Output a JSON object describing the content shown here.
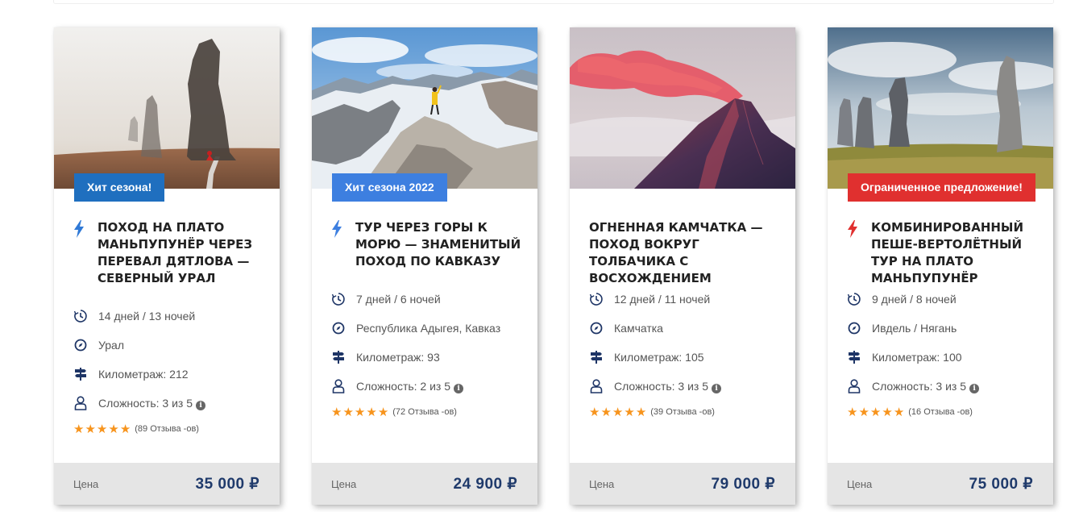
{
  "colors": {
    "accent_blue": "#2f79d6",
    "badge_blue_dark": "#1f6fbf",
    "badge_blue_light": "#3d7fe0",
    "badge_red": "#e0302f",
    "price_navy": "#1f3a6b",
    "star_orange": "#f7941d",
    "icon_navy": "#1e3566"
  },
  "cards": [
    {
      "badge": "Хит сезона!",
      "badge_color": "#1f6fbf",
      "bolt_color": "#2f79d6",
      "has_bolt": true,
      "title": "Поход на плато Маньпупунёр через перевал Дятлова — Северный Урал",
      "duration": "14 дней / 13 ночей",
      "location": "Урал",
      "mileage": "Километраж: 212",
      "difficulty": "Сложность: 3 из 5",
      "rating": 5,
      "reviews": "(89 Отзыва -ов)",
      "price_label": "Цена",
      "price": "35 000 ₽"
    },
    {
      "badge": "Хит сезона 2022",
      "badge_color": "#3d7fe0",
      "bolt_color": "#3d7fe0",
      "has_bolt": true,
      "title": "Тур через горы к морю — знаменитый поход по Кавказу",
      "duration": "7 дней / 6 ночей",
      "location": "Республика Адыгея, Кавказ",
      "mileage": "Километраж: 93",
      "difficulty": "Сложность: 2 из 5",
      "rating": 5,
      "reviews": "(72 Отзыва -ов)",
      "price_label": "Цена",
      "price": "24 900 ₽"
    },
    {
      "badge": "",
      "badge_color": "",
      "bolt_color": "",
      "has_bolt": false,
      "title": "Огненная Камчатка — поход вокруг Толбачика с восхождением",
      "duration": "12 дней / 11 ночей",
      "location": "Камчатка",
      "mileage": "Километраж: 105",
      "difficulty": "Сложность: 3 из 5",
      "rating": 5,
      "reviews": "(39 Отзыва -ов)",
      "price_label": "Цена",
      "price": "79 000 ₽"
    },
    {
      "badge": "Ограниченное предложение!",
      "badge_color": "#e0302f",
      "bolt_color": "#e0302f",
      "has_bolt": true,
      "title": "Комбинированный пеше-вертолётный тур на плато Маньпупунёр",
      "duration": "9 дней / 8 ночей",
      "location": "Ивдель / Нягань",
      "mileage": "Километраж: 100",
      "difficulty": "Сложность: 3 из 5",
      "rating": 5,
      "reviews": "(16 Отзыва -ов)",
      "price_label": "Цена",
      "price": "75 000 ₽"
    }
  ]
}
